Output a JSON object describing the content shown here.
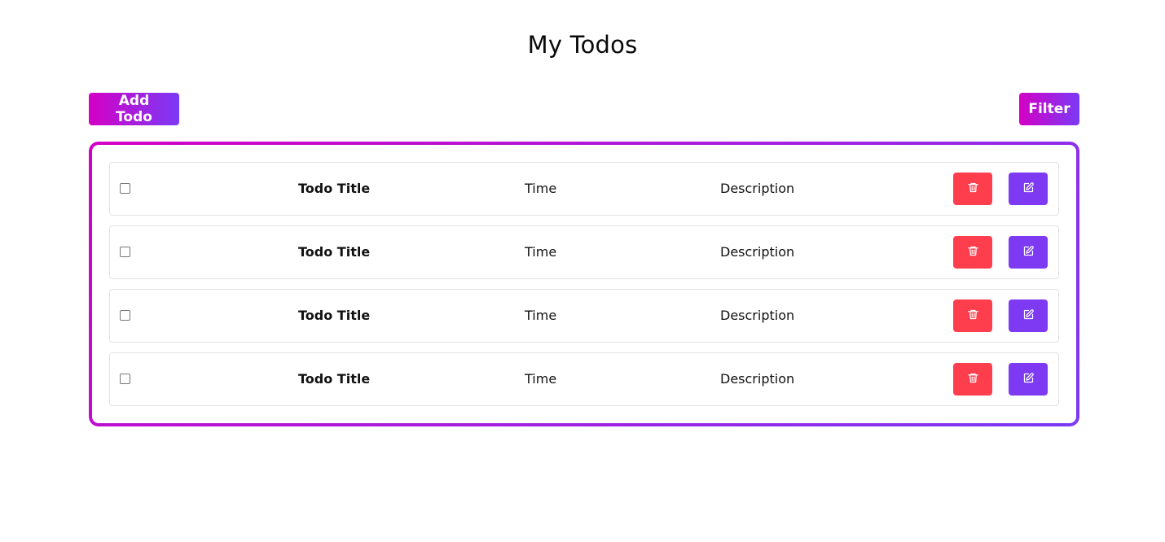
{
  "header": {
    "title": "My Todos"
  },
  "toolbar": {
    "add_label": "Add Todo",
    "filter_label": "Filter"
  },
  "colors": {
    "gradient_start": "#d300c5",
    "gradient_end": "#7b3af5",
    "delete": "#ff3e4d",
    "edit": "#7d3af2",
    "row_border": "#e3e3e3"
  },
  "todos": [
    {
      "checked": false,
      "title": "Todo Title",
      "time": "Time",
      "description": "Description",
      "delete_icon": "trash-icon",
      "edit_icon": "pencil-edit-icon"
    },
    {
      "checked": false,
      "title": "Todo Title",
      "time": "Time",
      "description": "Description",
      "delete_icon": "trash-icon",
      "edit_icon": "pencil-edit-icon"
    },
    {
      "checked": false,
      "title": "Todo Title",
      "time": "Time",
      "description": "Description",
      "delete_icon": "trash-icon",
      "edit_icon": "pencil-edit-icon"
    },
    {
      "checked": false,
      "title": "Todo Title",
      "time": "Time",
      "description": "Description",
      "delete_icon": "trash-icon",
      "edit_icon": "pencil-edit-icon"
    }
  ]
}
